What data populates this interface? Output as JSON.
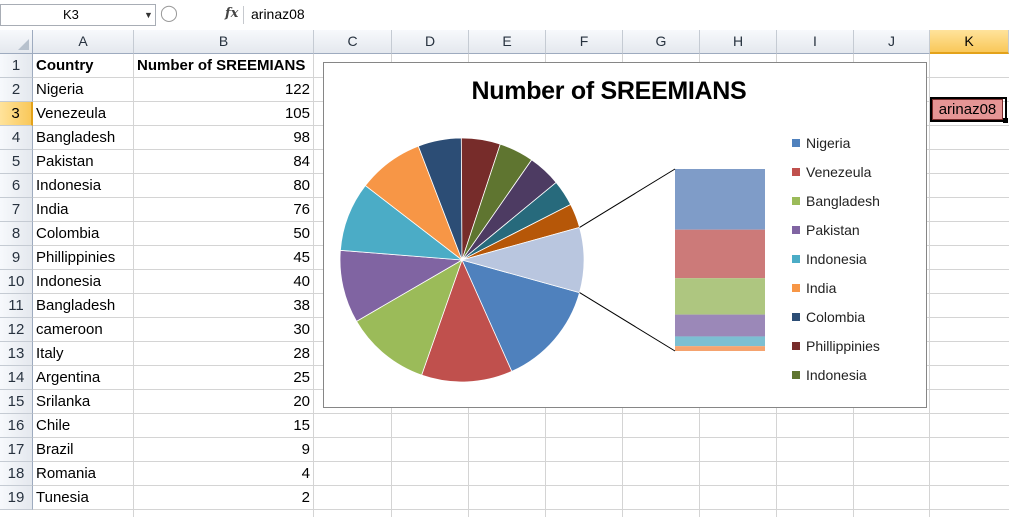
{
  "formula_bar": {
    "name_box": "K3",
    "fx_icon": "fx-function-icon",
    "formula": "arinaz08"
  },
  "grid": {
    "columns": [
      "A",
      "B",
      "C",
      "D",
      "E",
      "F",
      "G",
      "H",
      "I",
      "J",
      "K"
    ],
    "selected_column": "K",
    "rows": [
      "1",
      "2",
      "3",
      "4",
      "5",
      "6",
      "7",
      "8",
      "9",
      "10",
      "11",
      "12",
      "13",
      "14",
      "15",
      "16",
      "17",
      "18",
      "19"
    ],
    "selected_row": "3"
  },
  "table": {
    "headers": [
      "Country",
      "Number of SREEMIANS"
    ],
    "rows": [
      {
        "country": "Nigeria",
        "value": "122"
      },
      {
        "country": "Venezeula",
        "value": "105"
      },
      {
        "country": "Bangladesh",
        "value": "98"
      },
      {
        "country": "Pakistan",
        "value": "84"
      },
      {
        "country": "Indonesia",
        "value": "80"
      },
      {
        "country": "India",
        "value": "76"
      },
      {
        "country": "Colombia",
        "value": "50"
      },
      {
        "country": "Phillippinies",
        "value": "45"
      },
      {
        "country": "Indonesia",
        "value": "40"
      },
      {
        "country": "Bangladesh",
        "value": "38"
      },
      {
        "country": "cameroon",
        "value": "30"
      },
      {
        "country": "Italy",
        "value": "28"
      },
      {
        "country": "Argentina",
        "value": "25"
      },
      {
        "country": "Srilanka",
        "value": "20"
      },
      {
        "country": "Chile",
        "value": "15"
      },
      {
        "country": "Brazil",
        "value": "9"
      },
      {
        "country": "Romania",
        "value": "4"
      },
      {
        "country": "Tunesia",
        "value": "2"
      }
    ]
  },
  "selected_cell": {
    "address": "K3",
    "value": "arinaz08",
    "fill": "#e59595"
  },
  "chart_data": {
    "type": "pie",
    "subtype": "bar-of-pie",
    "title": "Number of SREEMIANS",
    "categories": [
      "Nigeria",
      "Venezeula",
      "Bangladesh",
      "Pakistan",
      "Indonesia",
      "India",
      "Colombia",
      "Phillippinies",
      "Indonesia",
      "Bangladesh",
      "cameroon",
      "Italy",
      "Argentina",
      "Srilanka",
      "Chile",
      "Brazil",
      "Romania",
      "Tunesia"
    ],
    "values": [
      122,
      105,
      98,
      84,
      80,
      76,
      50,
      45,
      40,
      38,
      30,
      28,
      25,
      20,
      15,
      9,
      4,
      2
    ],
    "secondary_plot_count": 6,
    "legend_position": "right",
    "legend_entries": [
      "Nigeria",
      "Venezeula",
      "Bangladesh",
      "Pakistan",
      "Indonesia",
      "India",
      "Colombia",
      "Phillippinies",
      "Indonesia"
    ],
    "colors": [
      "#4f81bd",
      "#c0504d",
      "#9bbb59",
      "#8064a2",
      "#4bacc6",
      "#f79646",
      "#2c4d75",
      "#772c2a",
      "#5f7530",
      "#4d3b62",
      "#276a7c",
      "#b65708",
      "#3a6397",
      "#9d3c3a",
      "#7a9a3f"
    ],
    "secondary_colors": [
      "#7f9cc8",
      "#cc7a79",
      "#aec680",
      "#9b88b8",
      "#7cbfd2",
      "#f5a36f"
    ],
    "other_color": "#b9c6df"
  }
}
